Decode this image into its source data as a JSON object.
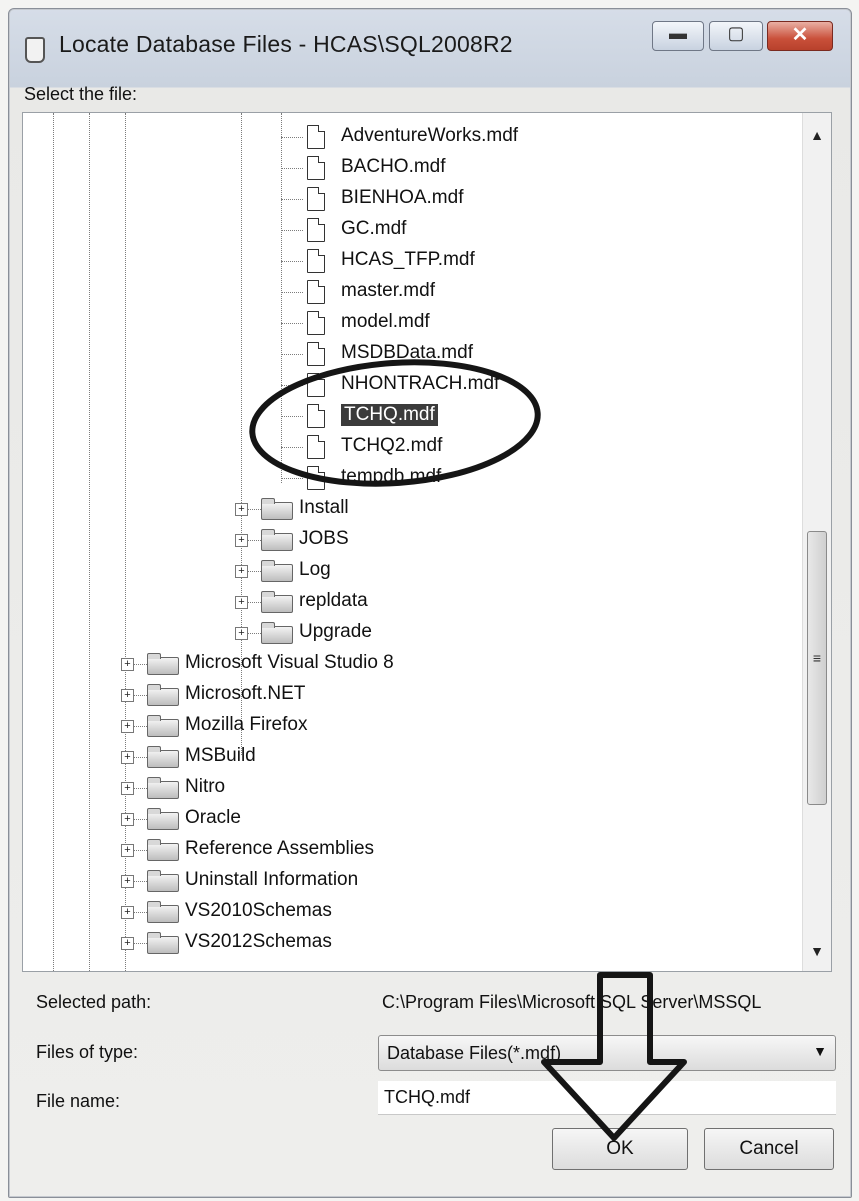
{
  "window": {
    "title": "Locate Database Files - HCAS\\SQL2008R2",
    "minimize_glyph": "▬",
    "maximize_glyph": "▢",
    "close_glyph": "✕"
  },
  "tree": {
    "label": "Select the file:",
    "files": [
      "AdventureWorks.mdf",
      "BACHO.mdf",
      "BIENHOA.mdf",
      "GC.mdf",
      "HCAS_TFP.mdf",
      "master.mdf",
      "model.mdf",
      "MSDBData.mdf",
      "NHONTRACH.mdf",
      "TCHQ.mdf",
      "TCHQ2.mdf",
      "tempdb.mdf"
    ],
    "selected_file": "TCHQ.mdf",
    "sub_folders": [
      "Install",
      "JOBS",
      "Log",
      "repldata",
      "Upgrade"
    ],
    "program_folders": [
      "Microsoft Visual Studio 8",
      "Microsoft.NET",
      "Mozilla Firefox",
      "MSBuild",
      "Nitro",
      "Oracle",
      "Reference Assemblies",
      "Uninstall Information",
      "VS2010Schemas",
      "VS2012Schemas"
    ],
    "expander_glyph": "+"
  },
  "scrollbar": {
    "up": "▲",
    "down": "▼",
    "grip": "≡"
  },
  "fields": {
    "selected_path_label": "Selected path:",
    "selected_path_value": "C:\\Program Files\\Microsoft SQL Server\\MSSQL",
    "files_of_type_label": "Files of type:",
    "files_of_type_value": "Database Files(*.mdf)",
    "file_name_label": "File name:",
    "file_name_value": "TCHQ.mdf"
  },
  "buttons": {
    "ok": "OK",
    "cancel": "Cancel"
  },
  "annotations": {
    "ink_color": "#151515"
  }
}
